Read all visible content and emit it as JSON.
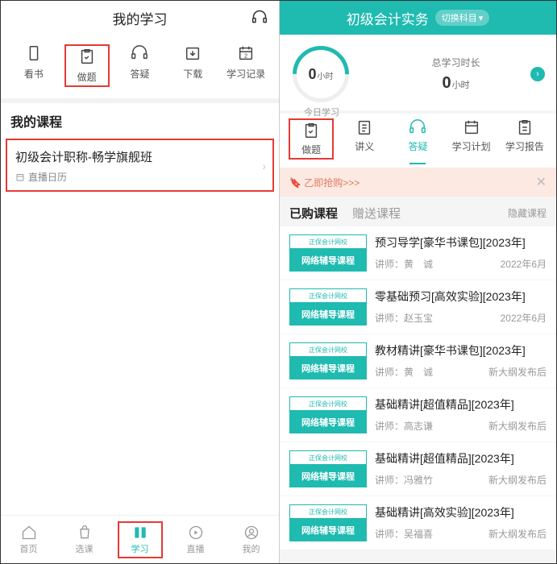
{
  "left": {
    "headerTitle": "我的学习",
    "topnav": [
      {
        "label": "看书"
      },
      {
        "label": "做题"
      },
      {
        "label": "答疑"
      },
      {
        "label": "下载"
      },
      {
        "label": "学习记录"
      }
    ],
    "sectionTitle": "我的课程",
    "course": {
      "title": "初级会计职称-畅学旗舰班",
      "sub": "直播日历"
    },
    "bottomnav": [
      {
        "label": "首页"
      },
      {
        "label": "选课"
      },
      {
        "label": "学习"
      },
      {
        "label": "直播"
      },
      {
        "label": "我的"
      }
    ]
  },
  "right": {
    "headerTitle": "初级会计实务",
    "switchLabel": "切换科目",
    "stats": {
      "todayNum": "0",
      "todayUnit": "小时",
      "todayLabel": "今日学习",
      "totalLabel": "总学习时长",
      "totalNum": "0",
      "totalUnit": "小时"
    },
    "tabs": [
      {
        "label": "做题"
      },
      {
        "label": "讲义"
      },
      {
        "label": "答疑"
      },
      {
        "label": "学习计划"
      },
      {
        "label": "学习报告"
      }
    ],
    "promo": "乙即抢购>>>",
    "ctabs": {
      "a": "已购课程",
      "b": "赠送课程",
      "hide": "隐藏课程"
    },
    "thumbTop": "正保会计网校",
    "thumbMain": "网络辅导课程",
    "courses": [
      {
        "title": "预习导学[豪华书课包][2023年]",
        "teacher": "讲师：黄　诚",
        "date": "2022年6月"
      },
      {
        "title": "零基础预习[高效实验][2023年]",
        "teacher": "讲师：赵玉宝",
        "date": "2022年6月"
      },
      {
        "title": "教材精讲[豪华书课包][2023年]",
        "teacher": "讲师：黄　诚",
        "date": "新大纲发布后"
      },
      {
        "title": "基础精讲[超值精品][2023年]",
        "teacher": "讲师：高志谦",
        "date": "新大纲发布后"
      },
      {
        "title": "基础精讲[超值精品][2023年]",
        "teacher": "讲师：冯雅竹",
        "date": "新大纲发布后"
      },
      {
        "title": "基础精讲[高效实验][2023年]",
        "teacher": "讲师：吴福喜",
        "date": "新大纲发布后"
      }
    ]
  }
}
